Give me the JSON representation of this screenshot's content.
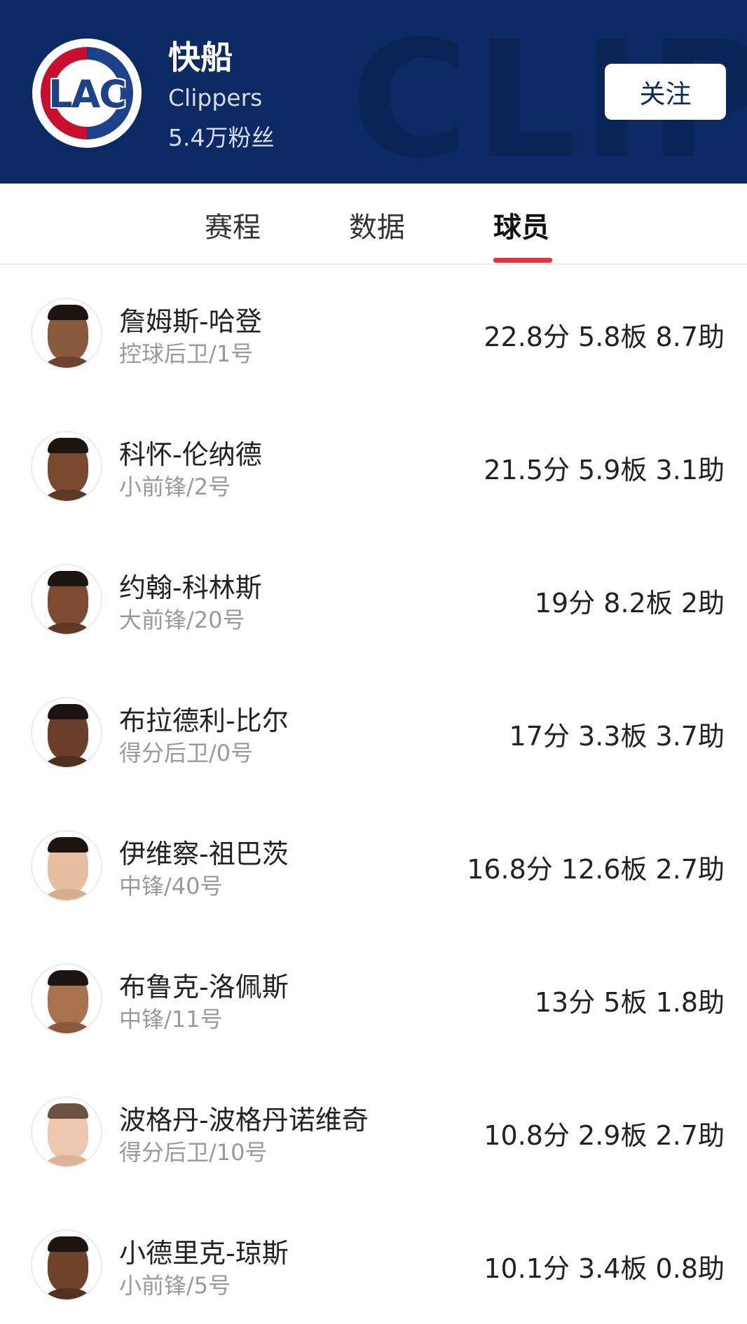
{
  "header": {
    "team_name": "快船",
    "team_en": "Clippers",
    "fans": "5.4万粉丝",
    "follow_label": "关注",
    "logo_text": "LAC",
    "watermark_text": "CLIPPE",
    "colors": {
      "background": "#0b2a63",
      "logo_red": "#c8102e",
      "logo_blue": "#1d428a"
    }
  },
  "tabs": [
    {
      "label": "赛程",
      "active": false
    },
    {
      "label": "数据",
      "active": false
    },
    {
      "label": "球员",
      "active": true
    }
  ],
  "accent_color": "#e8323c",
  "players": [
    {
      "name": "詹姆斯-哈登",
      "position": "控球后卫/1号",
      "stats": "22.8分 5.8板 8.7助",
      "avatar_icon": "player-avatar-icon"
    },
    {
      "name": "科怀-伦纳德",
      "position": "小前锋/2号",
      "stats": "21.5分 5.9板 3.1助",
      "avatar_icon": "player-avatar-icon"
    },
    {
      "name": "约翰-科林斯",
      "position": "大前锋/20号",
      "stats": "19分 8.2板 2助",
      "avatar_icon": "player-avatar-icon"
    },
    {
      "name": "布拉德利-比尔",
      "position": "得分后卫/0号",
      "stats": "17分 3.3板 3.7助",
      "avatar_icon": "player-avatar-icon"
    },
    {
      "name": "伊维察-祖巴茨",
      "position": "中锋/40号",
      "stats": "16.8分 12.6板 2.7助",
      "avatar_icon": "player-avatar-icon"
    },
    {
      "name": "布鲁克-洛佩斯",
      "position": "中锋/11号",
      "stats": "13分 5板 1.8助",
      "avatar_icon": "player-avatar-icon"
    },
    {
      "name": "波格丹-波格丹诺维奇",
      "position": "得分后卫/10号",
      "stats": "10.8分 2.9板 2.7助",
      "avatar_icon": "player-avatar-icon"
    },
    {
      "name": "小德里克-琼斯",
      "position": "小前锋/5号",
      "stats": "10.1分 3.4板 0.8助",
      "avatar_icon": "player-avatar-icon"
    }
  ]
}
